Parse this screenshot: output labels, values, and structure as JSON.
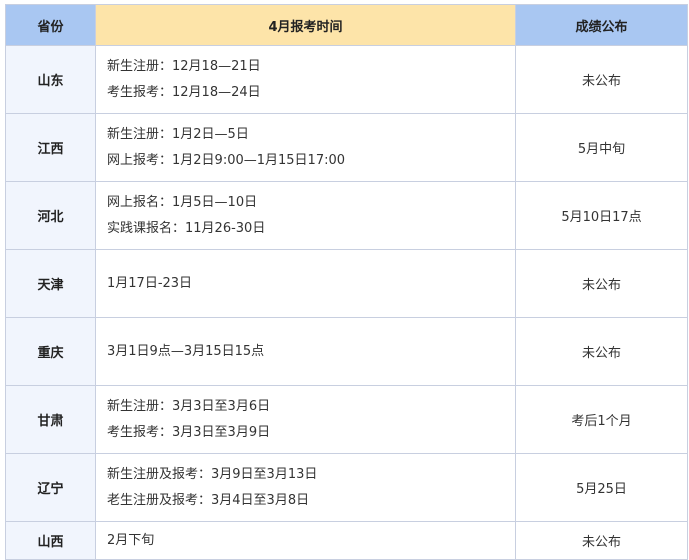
{
  "headers": {
    "province": "省份",
    "time": "4月报考时间",
    "score": "成绩公布"
  },
  "rows": [
    {
      "province": "山东",
      "lines": [
        "新生注册：12月18—21日",
        "考生报考：12月18—24日"
      ],
      "score": "未公布"
    },
    {
      "province": "江西",
      "lines": [
        "新生注册：1月2日—5日",
        "网上报考：1月2日9:00—1月15日17:00"
      ],
      "score": "5月中旬"
    },
    {
      "province": "河北",
      "lines": [
        "网上报名：1月5日—10日",
        "实践课报名：11月26-30日"
      ],
      "score": "5月10日17点"
    },
    {
      "province": "天津",
      "lines": [
        "1月17日-23日"
      ],
      "score": "未公布"
    },
    {
      "province": "重庆",
      "lines": [
        "3月1日9点—3月15日15点"
      ],
      "score": "未公布"
    },
    {
      "province": "甘肃",
      "lines": [
        "新生注册：3月3日至3月6日",
        "考生报考：3月3日至3月9日"
      ],
      "score": "考后1个月"
    },
    {
      "province": "辽宁",
      "lines": [
        "新生注册及报考：3月9日至3月13日",
        "老生注册及报考：3月4日至3月8日"
      ],
      "score": "5月25日"
    },
    {
      "province": "山西",
      "lines": [
        "2月下旬"
      ],
      "score": "未公布"
    }
  ]
}
